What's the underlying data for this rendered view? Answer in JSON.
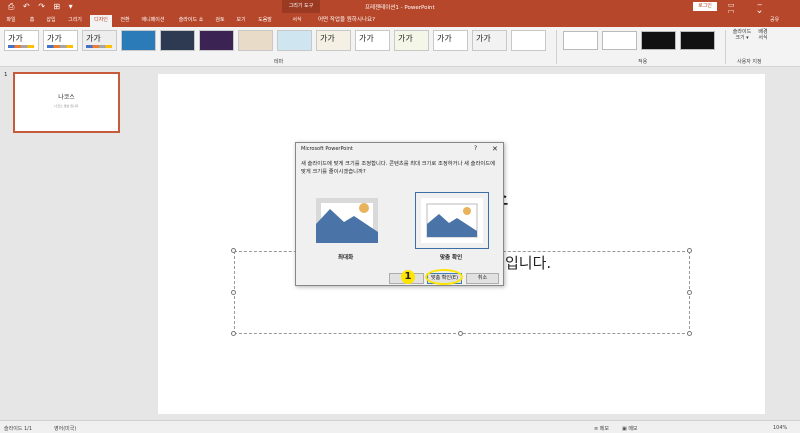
{
  "titlebar": {
    "quick_access": "⎙ ↶ ↷ ⊞ ▾",
    "context_tab": "그리기 도구",
    "document": "프레젠테이션1 - PowerPoint",
    "login": "로그인",
    "window_controls": "▭ − ☐ ✕"
  },
  "tabs": [
    {
      "label": "파일"
    },
    {
      "label": "홈"
    },
    {
      "label": "삽입"
    },
    {
      "label": "그리기"
    },
    {
      "label": "디자인"
    },
    {
      "label": "전환"
    },
    {
      "label": "애니메이션"
    },
    {
      "label": "슬라이드 쇼"
    },
    {
      "label": "검토"
    },
    {
      "label": "보기"
    },
    {
      "label": "도움말"
    },
    {
      "label": "서식"
    }
  ],
  "tell_me": "어떤 작업을 원하시나요?",
  "share": "공유",
  "ribbon": {
    "theme_sample": "가가",
    "theme_group": "테마",
    "variant_group": "적용",
    "customize_group": "사용자 지정",
    "slide_size": "슬라이드 크기 ▾",
    "format_bg": "배경 서식"
  },
  "thumbnail": {
    "number": "1",
    "title": "나코스",
    "subtitle": "나코스 영상 입니다"
  },
  "slide": {
    "title_tail": "스",
    "subtitle_tail": "입니다."
  },
  "dialog": {
    "title": "Microsoft PowerPoint",
    "help": "?",
    "close": "✕",
    "message": "새 슬라이드에 맞게 크기를 조정합니다. 콘텐츠를 최대 크기로 조정하거나 새 슬라이드에 맞게 크기를 줄이시겠습니까?",
    "option_max": "최대화",
    "option_fit": "맞춤 확인",
    "btn_max": "최",
    "btn_fit": "맞춤 확인(E)",
    "btn_cancel": "취소"
  },
  "marker": "1",
  "status": {
    "slide": "슬라이드 1/1",
    "lang": "영어(미국)",
    "notes": "≡ 메모",
    "comments": "▣ 메모",
    "zoom": "104%"
  },
  "colors": {
    "accent": "#b7472a",
    "marker": "#ffe500",
    "selected": "#3c6ea8",
    "mountain": "#4a74a7",
    "sun": "#e8b35a"
  }
}
